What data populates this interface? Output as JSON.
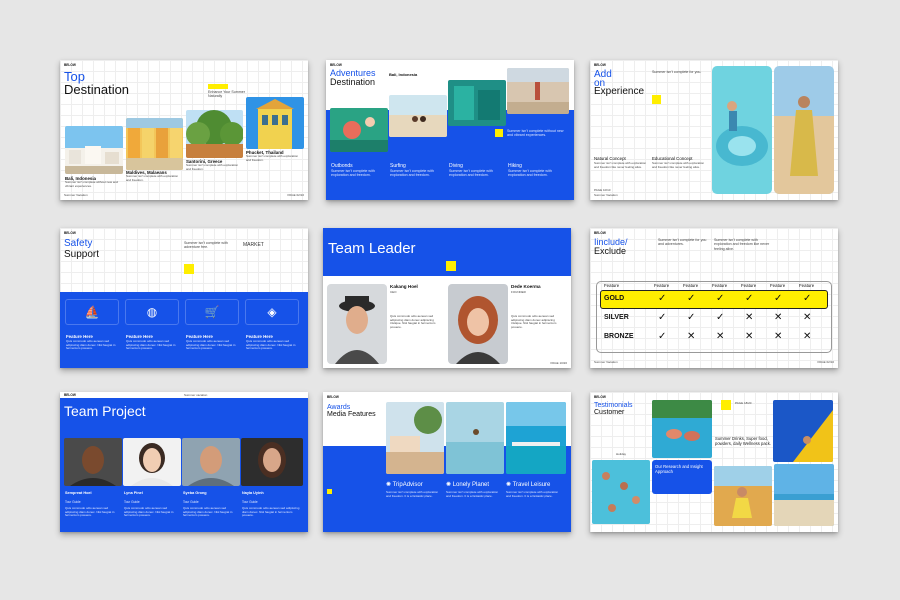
{
  "brand": "BELOW",
  "accent_colors": {
    "blue": "#1652e8",
    "yellow": "#ffee00"
  },
  "slide1": {
    "title_line1": "Top",
    "title_line2": "Destination",
    "note": "Enhance Your Summer Naturally",
    "places": [
      {
        "name": "Bali, Indonesia",
        "desc": "Summer isn't complete without new and vibrant experiences."
      },
      {
        "name": "Maldives, Malaeans",
        "desc": "Summer isn't complete with exploration and freedom."
      },
      {
        "name": "Santorini, Greece",
        "desc": "Summer isn't complete with exploration and freedom."
      },
      {
        "name": "Phucket, Thailand",
        "desc": "Summer isn't complete with exploration and freedom."
      }
    ],
    "footer_left": "Summer Vacation",
    "footer_right": "PAGE 02/10"
  },
  "slide2": {
    "title_line1": "Adventures",
    "title_line2": "Destination",
    "location": "Bali, Indonesia",
    "note": "Summer isn't complete without new and vibrant experiences.",
    "categories": [
      {
        "name": "Outbonds",
        "desc": "Summer isn't complete with exploration and freedom."
      },
      {
        "name": "Surfing",
        "desc": "Summer isn't complete with exploration and freedom."
      },
      {
        "name": "Diving",
        "desc": "Summer isn't complete with exploration and freedom."
      },
      {
        "name": "Hiking",
        "desc": "Summer isn't complete with exploration and freedom."
      }
    ]
  },
  "slide3": {
    "title_line1": "Add",
    "title_line2": "on",
    "title_line3": "Experience",
    "note": "Summer isn't complete for you.",
    "concepts": [
      {
        "name": "Natural Concept",
        "desc": "Summer isn't complete with exploration and freedom like never feeling alive."
      },
      {
        "name": "Educational Concept",
        "desc": "Summer isn't complete with exploration and freedom like never feeling alive."
      }
    ],
    "footer_left": "PAGE 10/10",
    "footer_sub": "Summer Vacation"
  },
  "slide4": {
    "title_line1": "Safety",
    "title_line2": "Support",
    "note": "Summer isn't complete with adventure free.",
    "market": "MARKET",
    "features": [
      {
        "name": "Feature Here",
        "desc": "Quis commodo odio aenean sed adipiscing diam donec. Nisl faugiat in fermentum posuere."
      },
      {
        "name": "Feature Here",
        "desc": "Quis commodo odio aenean sed adipiscing diam donec. Nisl faugiat in fermentum posuere."
      },
      {
        "name": "Feature Here",
        "desc": "Quis commodo odio aenean sed adipiscing diam donec. Nisl faugiat in fermentum posuere."
      },
      {
        "name": "Feature Here",
        "desc": "Quis commodo odio aenean sed adipiscing diam donec. Nisl faugiat in fermentum posuere."
      }
    ]
  },
  "slide5": {
    "title": "Team Leader",
    "people": [
      {
        "name": "Kakang Hoel",
        "role": "CEO",
        "desc": "Quis commodo odio aenean sed adipiscing diam donec adipiscing tristique. Nisl faugiat in fermentum posuere."
      },
      {
        "name": "Dede Koerma",
        "role": "FOUNDER",
        "desc": "Quis commodo odio aenean sed adipiscing diam donec adipiscing tristique. Nisl faugiat in fermentum posuere."
      }
    ],
    "footer_right": "PAGE 10/20"
  },
  "slide6": {
    "title_line1": "Iinclude/",
    "title_line2": "Exclude",
    "note1": "Summer isn't complete for you and adventures.",
    "note2": "Summer isn't complete with exploration and freedom like never feeling alive.",
    "headers": [
      "Feature",
      "Feature",
      "Feature",
      "Feature",
      "Feature",
      "Feature",
      "Feature"
    ],
    "rows": [
      {
        "tier": "GOLD",
        "marks": [
          "✓",
          "✓",
          "✓",
          "✓",
          "✓",
          "✓"
        ]
      },
      {
        "tier": "SILVER",
        "marks": [
          "✓",
          "✓",
          "✓",
          "✕",
          "✕",
          "✕"
        ]
      },
      {
        "tier": "BRONZE",
        "marks": [
          "✓",
          "✕",
          "✕",
          "✕",
          "✕",
          "✕"
        ]
      }
    ],
    "footer_left": "Summer Vacation",
    "footer_right": "PAGE 02/10"
  },
  "slide7": {
    "title": "Team Project",
    "header_note": "Summer vacation",
    "members": [
      {
        "name": "Sempreat Hoel",
        "role": "Tour Guide",
        "desc": "Quis commodo odio aenean sed adipiscing diam donec. Nisl faugiat in fermentum posuere."
      },
      {
        "name": "Lyna Pinel",
        "role": "Tour Guide",
        "desc": "Quis commodo odio aenean sed adipiscing diam donec. Nisl faugiat in fermentum posuere."
      },
      {
        "name": "Syeba Grong",
        "role": "Tour Guide",
        "desc": "Quis commodo odio aenean sed adipiscing diam donec. Nisl faugiat in fermentum posuere."
      },
      {
        "name": "Nayla Uyinh",
        "role": "Tour Guide",
        "desc": "Quis commodo odio aenean sed adipiscing diam donec. Nisl faugiat in fermentum posuere."
      }
    ]
  },
  "slide8": {
    "title_line1": "Awards",
    "title_line2": "Media Features",
    "awards": [
      {
        "name": "TripAdvisor",
        "desc": "Summer isn't complete with exploration and freedom. It is a fantastic place."
      },
      {
        "name": "Lonely Planet",
        "desc": "Summer isn't complete with exploration and freedom. It is a fantastic place."
      },
      {
        "name": "Travel Leisure",
        "desc": "Summer isn't complete with exploration and freedom. It is a fantastic place."
      }
    ]
  },
  "slide9": {
    "title_line1": "Testimonials",
    "title_line2": "Customer",
    "page": "PAGE 18/20",
    "quote": "Summer Drinks, Super food, powders, daily Wellness pack.",
    "research": "Our Research and Insight Approach",
    "tag": "Holiday"
  }
}
